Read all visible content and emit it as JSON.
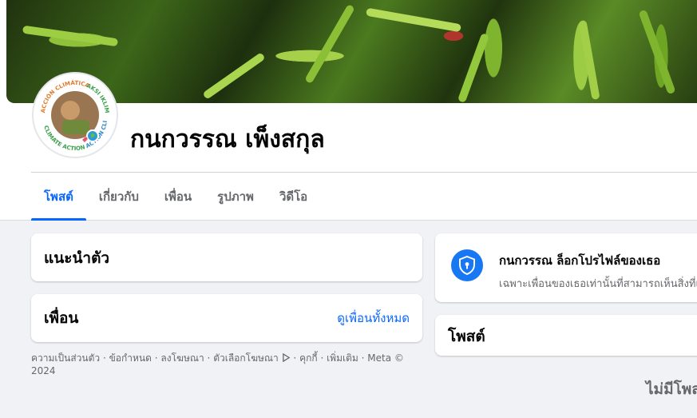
{
  "profile": {
    "name": "กนกวรรณ เพ็งสกุล",
    "avatar_ring_text_top": "AKSI IKLIM",
    "avatar_ring_text_left": "ACCIÓN CLIMÁTICA",
    "avatar_ring_text_right": "ACTION CLIMAT",
    "avatar_ring_text_bottom": "CLIMATE ACTION"
  },
  "tabs": [
    {
      "label": "โพสต์",
      "active": true
    },
    {
      "label": "เกี่ยวกับ",
      "active": false
    },
    {
      "label": "เพื่อน",
      "active": false
    },
    {
      "label": "รูปภาพ",
      "active": false
    },
    {
      "label": "วิดีโอ",
      "active": false
    }
  ],
  "intro": {
    "title": "แนะนำตัว"
  },
  "friends": {
    "title": "เพื่อน",
    "see_all": "ดูเพื่อนทั้งหมด"
  },
  "footer": {
    "links": [
      "ความเป็นส่วนตัว",
      "ข้อกำหนด",
      "ลงโฆษณา",
      "ตัวเลือกโฆษณา",
      "คุกกี้",
      "เพิ่มเติม"
    ],
    "copyright": "Meta © 2024"
  },
  "locked": {
    "title": "กนกวรรณ ล็อกโปรไฟล์ของเธอ",
    "subtitle": "เฉพาะเพื่อนของเธอเท่านั้นที่สามารถเห็นสิ่งที่เธอแชร์"
  },
  "posts": {
    "title": "โพสต์",
    "empty": "ไม่มีโพสต์"
  },
  "colors": {
    "accent": "#0866ff",
    "shield": "#1877f2",
    "page_bg": "#f0f2f5"
  },
  "icons": [
    "shield-lock-icon",
    "adchoices-icon"
  ]
}
